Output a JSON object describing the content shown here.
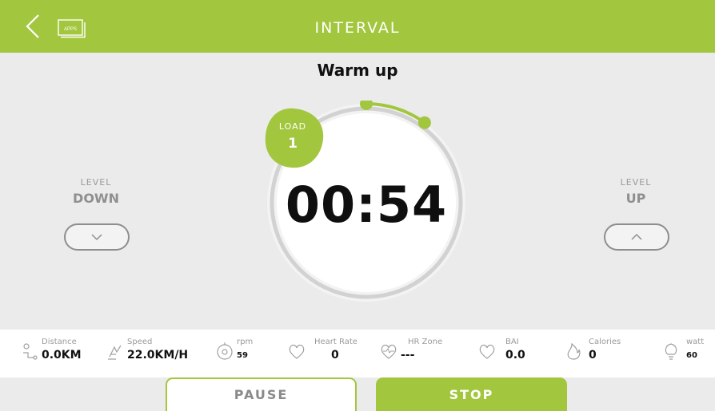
{
  "header": {
    "title": "INTERVAL",
    "apps_label": "APPS",
    "color": "#a3c63f"
  },
  "workout": {
    "phase": "Warm up",
    "timer": "00:54",
    "load_label": "LOAD",
    "load_value": "1"
  },
  "level_down": {
    "small": "LEVEL",
    "big": "DOWN",
    "icon": "chevron-down-icon"
  },
  "level_up": {
    "small": "LEVEL",
    "big": "UP",
    "icon": "chevron-up-icon"
  },
  "stats": [
    {
      "label": "Distance",
      "value": "0.0KM",
      "icon": "distance-icon"
    },
    {
      "label": "Speed",
      "value": "22.0KM/H",
      "icon": "speed-icon"
    },
    {
      "label": "rpm",
      "value": "59",
      "icon": "rpm-icon"
    },
    {
      "label": "Heart Rate",
      "value": "0",
      "icon": "heart-icon"
    },
    {
      "label": "HR Zone",
      "value": "---",
      "icon": "hr-zone-icon"
    },
    {
      "label": "BAI",
      "value": "0.0",
      "icon": "bai-icon"
    },
    {
      "label": "Calories",
      "value": "0",
      "icon": "flame-icon"
    },
    {
      "label": "watt",
      "value": "60",
      "icon": "bulb-icon"
    }
  ],
  "actions": {
    "pause": "PAUSE",
    "stop": "STOP"
  },
  "colors": {
    "accent": "#a3c63f",
    "background": "#ebebeb",
    "track": "#d4d4d4",
    "progress": "#a3c63f"
  }
}
